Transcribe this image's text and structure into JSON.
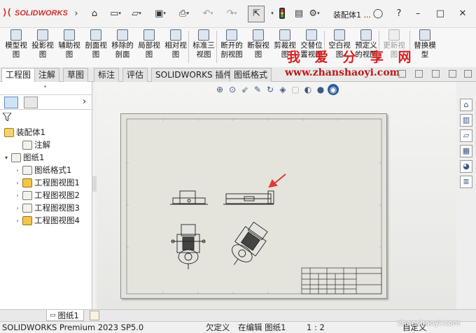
{
  "titlebar": {
    "brand": "SOLIDWORKS",
    "document_title": "装配体1 ..."
  },
  "command_manager": {
    "buttons": [
      {
        "id": "model-view",
        "label": "模型视\n图",
        "enabled": true
      },
      {
        "id": "projected-view",
        "label": "投影视\n图",
        "enabled": true
      },
      {
        "id": "auxiliary-view",
        "label": "辅助视\n图",
        "enabled": true
      },
      {
        "id": "section-view",
        "label": "剖面视\n图",
        "enabled": true
      },
      {
        "id": "removed-section",
        "label": "移除的\n剖面",
        "enabled": true
      },
      {
        "id": "detail-view",
        "label": "局部视\n图",
        "enabled": true
      },
      {
        "id": "relative-view",
        "label": "相对视\n图",
        "enabled": true
      },
      {
        "id": "standard-3-view",
        "label": "标准三\n视图",
        "enabled": true
      },
      {
        "id": "broken-out-section",
        "label": "断开的\n剖视图",
        "enabled": true
      },
      {
        "id": "break-view",
        "label": "断裂视\n图",
        "enabled": true
      },
      {
        "id": "crop-view",
        "label": "剪裁视\n图",
        "enabled": true
      },
      {
        "id": "alternate-position",
        "label": "交替位\n置视图",
        "enabled": true
      },
      {
        "id": "empty-view",
        "label": "空白视\n图",
        "enabled": true
      },
      {
        "id": "predefined-view",
        "label": "预定义\n的视图",
        "enabled": true
      },
      {
        "id": "update-view",
        "label": "更新视\n图",
        "enabled": false
      },
      {
        "id": "replace-model",
        "label": "替换模\n型",
        "enabled": true
      }
    ]
  },
  "tabs": [
    "工程图",
    "注解",
    "草图",
    "标注",
    "评估",
    "SOLIDWORKS 插件",
    "图纸格式"
  ],
  "active_tab": 0,
  "watermark": {
    "line1": "我 爱 分 享 网",
    "line2": "www.zhanshaoyi.com",
    "line3": "zhanshaoyi.com"
  },
  "feature_tree": {
    "root": "装配体1",
    "items": [
      {
        "label": "注解",
        "indent": 1,
        "expander": ""
      },
      {
        "label": "图纸1",
        "indent": 0,
        "expander": "▾"
      },
      {
        "label": "图纸格式1",
        "indent": 1,
        "expander": "›"
      },
      {
        "label": "工程图视图1",
        "indent": 1,
        "expander": "›"
      },
      {
        "label": "工程图视图2",
        "indent": 1,
        "expander": "›"
      },
      {
        "label": "工程图视图3",
        "indent": 1,
        "expander": "›"
      },
      {
        "label": "工程图视图4",
        "indent": 1,
        "expander": "›"
      }
    ]
  },
  "sheet_tab": "图纸1",
  "status": {
    "product": "SOLIDWORKS Premium 2023 SP5.0",
    "defined": "欠定义",
    "editing": "在编辑 图纸1",
    "scale": "1 : 2",
    "custom": "自定义"
  },
  "colors": {
    "brand_red": "#d0312d",
    "watermark_red": "#d62020",
    "arrow_red": "#e03a3a"
  }
}
